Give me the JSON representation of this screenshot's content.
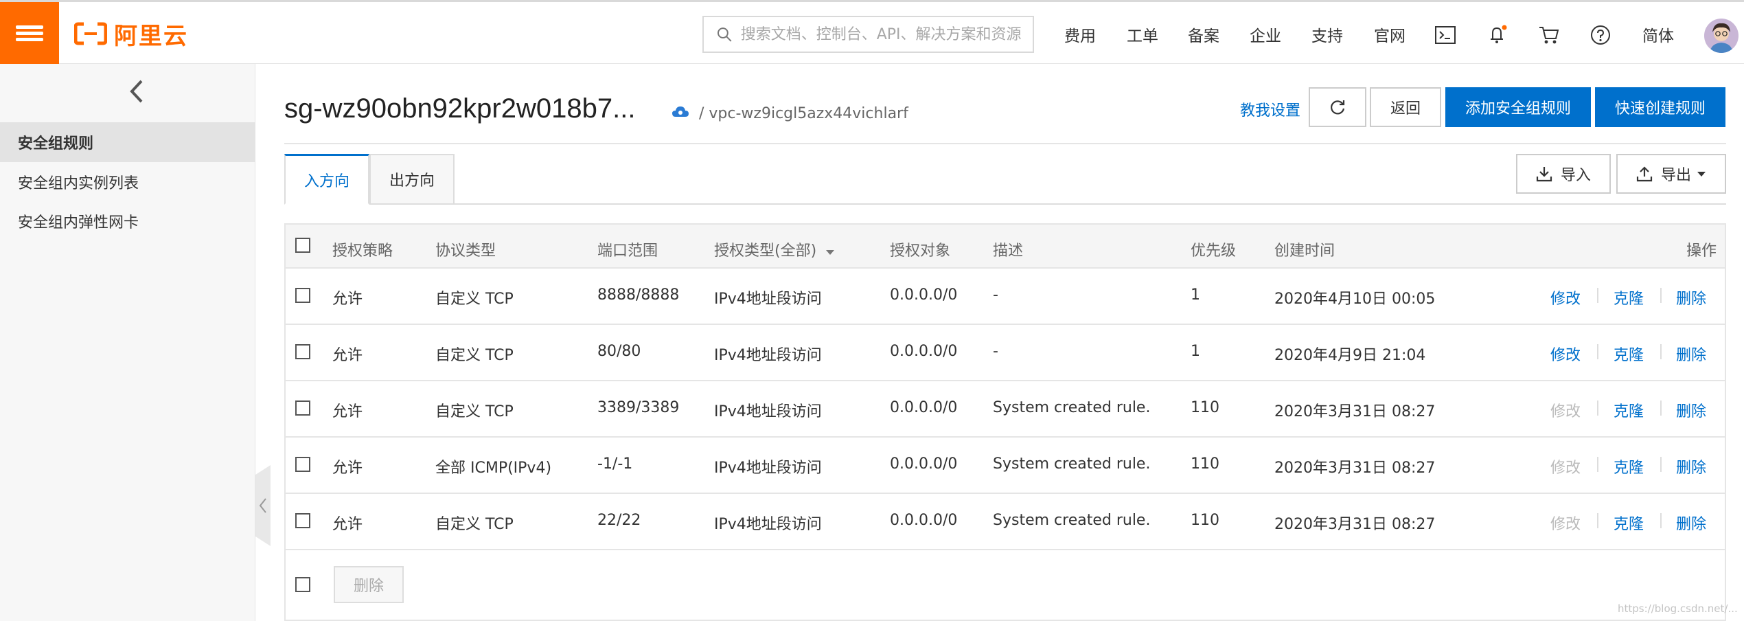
{
  "header": {
    "logo_text": "阿里云",
    "search_placeholder": "搜索文档、控制台、API、解决方案和资源",
    "nav": [
      "费用",
      "工单",
      "备案",
      "企业",
      "支持",
      "官网"
    ],
    "lang": "简体",
    "brand_color": "#ff6a00"
  },
  "sidebar": {
    "items": [
      {
        "label": "安全组规则",
        "active": true
      },
      {
        "label": "安全组内实例列表"
      },
      {
        "label": "安全组内弹性网卡"
      }
    ]
  },
  "main": {
    "title": "sg-wz90obn92kpr2w018b7...",
    "vpc": "/ vpc-wz9icgl5azx44vichlarf",
    "teach_link": "教我设置",
    "back_btn": "返回",
    "add_rule_btn": "添加安全组规则",
    "quick_rule_btn": "快速创建规则",
    "tabs": [
      "入方向",
      "出方向"
    ],
    "import_btn": "导入",
    "export_btn": "导出",
    "accent_color": "#0070cc"
  },
  "table": {
    "headers": {
      "policy": "授权策略",
      "protocol": "协议类型",
      "port": "端口范围",
      "auth_type": "授权类型(全部)",
      "auth_obj": "授权对象",
      "desc": "描述",
      "priority": "优先级",
      "created": "创建时间",
      "ops": "操作"
    },
    "rows": [
      {
        "policy": "允许",
        "protocol": "自定义 TCP",
        "port": "8888/8888",
        "auth_type": "IPv4地址段访问",
        "auth_obj": "0.0.0.0/0",
        "desc": "-",
        "priority": "1",
        "created": "2020年4月10日 00:05",
        "edit_enabled": true
      },
      {
        "policy": "允许",
        "protocol": "自定义 TCP",
        "port": "80/80",
        "auth_type": "IPv4地址段访问",
        "auth_obj": "0.0.0.0/0",
        "desc": "-",
        "priority": "1",
        "created": "2020年4月9日 21:04",
        "edit_enabled": true
      },
      {
        "policy": "允许",
        "protocol": "自定义 TCP",
        "port": "3389/3389",
        "auth_type": "IPv4地址段访问",
        "auth_obj": "0.0.0.0/0",
        "desc": "System created rule.",
        "priority": "110",
        "created": "2020年3月31日 08:27",
        "edit_enabled": false
      },
      {
        "policy": "允许",
        "protocol": "全部 ICMP(IPv4)",
        "port": "-1/-1",
        "auth_type": "IPv4地址段访问",
        "auth_obj": "0.0.0.0/0",
        "desc": "System created rule.",
        "priority": "110",
        "created": "2020年3月31日 08:27",
        "edit_enabled": false
      },
      {
        "policy": "允许",
        "protocol": "自定义 TCP",
        "port": "22/22",
        "auth_type": "IPv4地址段访问",
        "auth_obj": "0.0.0.0/0",
        "desc": "System created rule.",
        "priority": "110",
        "created": "2020年3月31日 08:27",
        "edit_enabled": false
      }
    ],
    "ops": {
      "edit": "修改",
      "clone": "克隆",
      "delete": "删除"
    },
    "bulk_delete": "删除"
  },
  "watermark": "https://blog.csdn.net/..."
}
